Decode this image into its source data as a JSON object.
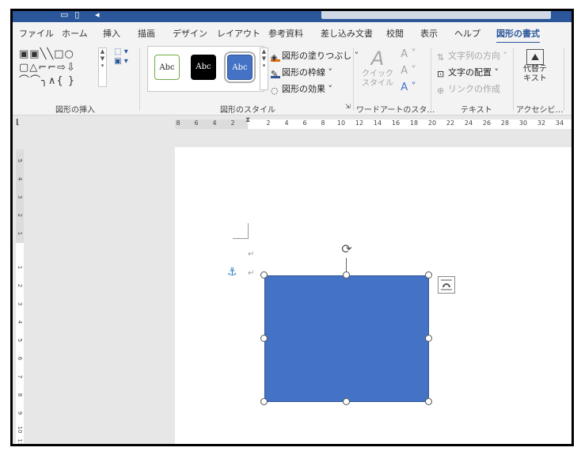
{
  "ribbon_tabs": [
    "ファイル",
    "ホーム",
    "挿入",
    "描画",
    "デザイン",
    "レイアウト",
    "参考資料",
    "差し込み文書",
    "校閲",
    "表示",
    "ヘルプ",
    "図形の書式"
  ],
  "active_tab": "図形の書式",
  "groups": {
    "insert_shapes": {
      "label": "図形の挿入",
      "shapes_rows": [
        "▣▣╲╲□○",
        "▢△⌐⌐⇨⇩",
        "⌒⌒╮∧{ }"
      ]
    },
    "shape_styles": {
      "label": "図形のスタイル",
      "samples": [
        "Abc",
        "Abc",
        "Abc"
      ],
      "fill_label": "図形の塗りつぶし",
      "outline_label": "図形の枠線",
      "effects_label": "図形の効果"
    },
    "wordart": {
      "label": "ワードアートのスタ…",
      "quick_style_label": "クイック スタイル"
    },
    "text": {
      "label": "テキスト",
      "direction_label": "文字列の方向",
      "align_label": "文字の配置",
      "link_label": "リンクの作成"
    },
    "accessibility": {
      "label": "アクセシビ…",
      "alt_text_label": "代替テキスト"
    }
  },
  "ruler": {
    "horizontal_labels": [
      "8",
      "6",
      "4",
      "2",
      "2",
      "4",
      "6",
      "8",
      "10",
      "12",
      "14",
      "16",
      "18",
      "20",
      "22",
      "24",
      "26",
      "28",
      "30",
      "32",
      "34"
    ],
    "vertical_labels": [
      "5",
      "4",
      "3",
      "2",
      "1",
      "1",
      "2",
      "3",
      "4",
      "5",
      "6",
      "7",
      "8",
      "9",
      "10",
      "11"
    ]
  },
  "colors": {
    "accent": "#2b579a",
    "shape_fill": "#4472c4",
    "shape_border": "#2f5597"
  },
  "icons": [
    "quick-access-icons",
    "paint-bucket-icon",
    "pen-outline-icon",
    "effects-icon",
    "wordart-a-icon",
    "text-direction-icon",
    "text-align-icon",
    "link-icon",
    "alt-text-icon",
    "anchor-icon",
    "rotate-icon",
    "layout-options-icon"
  ]
}
